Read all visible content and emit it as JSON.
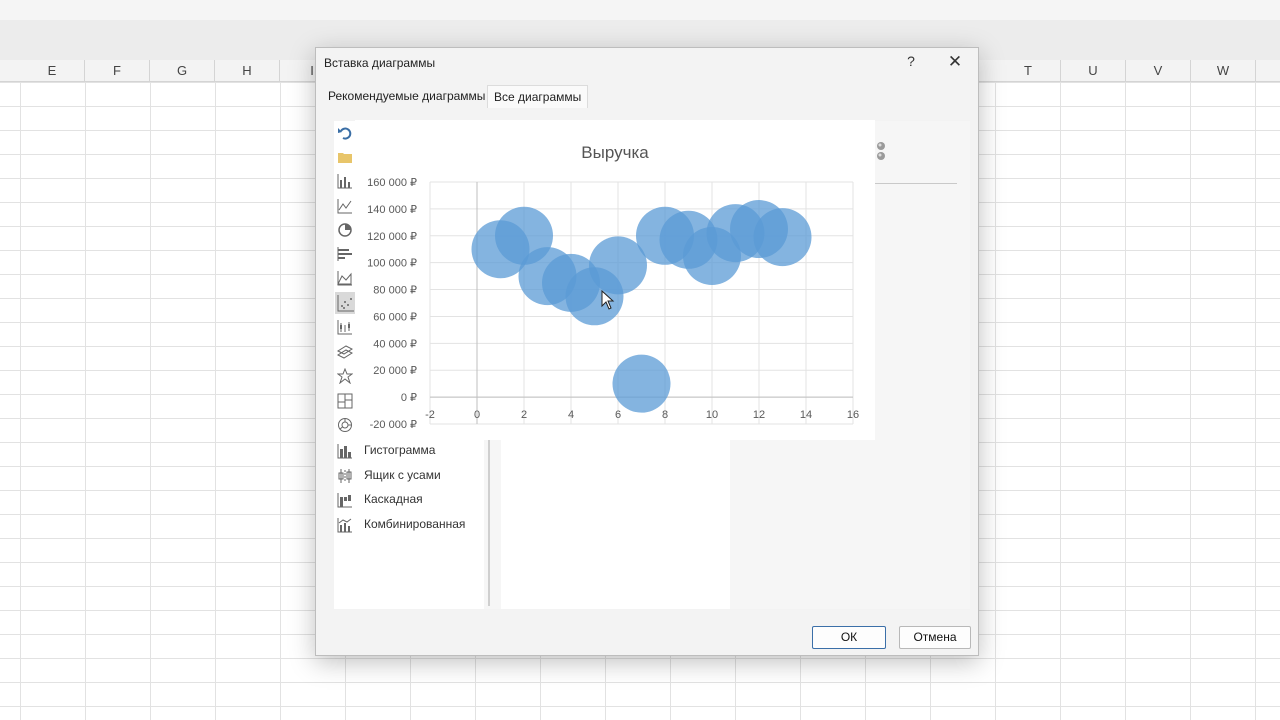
{
  "sheet": {
    "columns_left": [
      "E",
      "F",
      "G",
      "H",
      "I"
    ],
    "columns_right": [
      "T",
      "U",
      "V",
      "W"
    ]
  },
  "dialog": {
    "title": "Вставка диаграммы",
    "help_glyph": "?",
    "close_glyph": "✕",
    "tabs": [
      {
        "label": "Рекомендуемые диаграммы",
        "active": false
      },
      {
        "label": "Все диаграммы",
        "active": true
      }
    ],
    "chart_types_icons_only": [
      "undo-icon",
      "folder-icon",
      "column-chart-icon",
      "line-chart-icon",
      "pie-chart-icon",
      "bar-chart-icon",
      "area-chart-icon",
      "scatter-chart-icon",
      "stock-chart-icon",
      "surface-chart-icon",
      "radar-chart-icon",
      "treemap-chart-icon",
      "sunburst-chart-icon"
    ],
    "chart_types_labeled": [
      {
        "icon": "histogram-icon",
        "label": "Гистограмма"
      },
      {
        "icon": "box-whisker-icon",
        "label": "Ящик с усами"
      },
      {
        "icon": "waterfall-icon",
        "label": "Каскадная"
      },
      {
        "icon": "combo-chart-icon",
        "label": "Комбинированная"
      }
    ],
    "ok_label": "ОК",
    "cancel_label": "Отмена"
  },
  "chart_data": {
    "type": "scatter",
    "subtype": "bubble",
    "title": "Выручка",
    "xlim": [
      -2,
      16
    ],
    "ylim": [
      -20000,
      160000
    ],
    "x_ticks": [
      "-2",
      "0",
      "2",
      "4",
      "6",
      "8",
      "10",
      "12",
      "14",
      "16"
    ],
    "y_ticks": [
      "160 000 ₽",
      "140 000 ₽",
      "120 000 ₽",
      "100 000 ₽",
      "80 000 ₽",
      "60 000 ₽",
      "40 000 ₽",
      "20 000 ₽",
      "0 ₽",
      "-20 000 ₽"
    ],
    "bubble_color": "#5b9bd5",
    "grid": true,
    "points": [
      {
        "x": 1,
        "y": 110000
      },
      {
        "x": 2,
        "y": 120000
      },
      {
        "x": 3,
        "y": 90000
      },
      {
        "x": 4,
        "y": 85000
      },
      {
        "x": 5,
        "y": 75000
      },
      {
        "x": 6,
        "y": 98000
      },
      {
        "x": 7,
        "y": 10000
      },
      {
        "x": 8,
        "y": 120000
      },
      {
        "x": 9,
        "y": 117000
      },
      {
        "x": 10,
        "y": 105000
      },
      {
        "x": 11,
        "y": 122000
      },
      {
        "x": 12,
        "y": 125000
      },
      {
        "x": 13,
        "y": 119000
      }
    ]
  }
}
